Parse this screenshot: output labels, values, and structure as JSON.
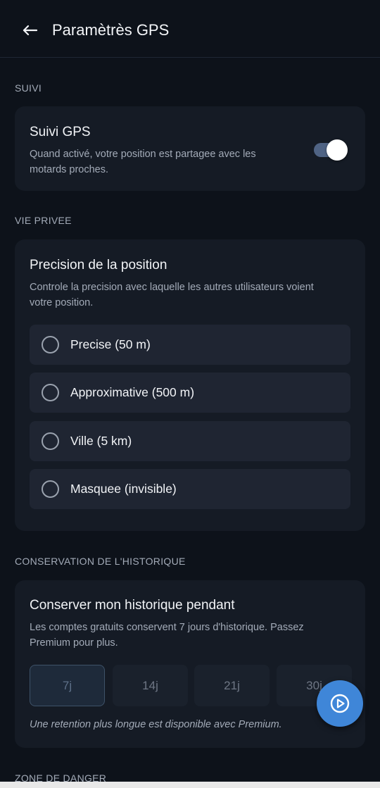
{
  "header": {
    "title": "Paramètrès GPS",
    "back_icon": "arrow-left-icon"
  },
  "sections": {
    "suivi": {
      "header": "SUIVI",
      "card": {
        "title": "Suivi GPS",
        "description_line1": "Quand activé, votre position est partagee avec les",
        "description_line2": "motards proches.",
        "toggle_on": true
      }
    },
    "privacy": {
      "header": "VIE PRIVEE",
      "card": {
        "title": "Precision de la position",
        "description_line1": "Controle la precision avec laquelle les autres utilisateurs voient",
        "description_line2": "votre position.",
        "options": [
          {
            "label": "Precise (50 m)",
            "selected": false
          },
          {
            "label": "Approximative (500 m)",
            "selected": false
          },
          {
            "label": "Ville (5 km)",
            "selected": false
          },
          {
            "label": "Masquee (invisible)",
            "selected": false
          }
        ]
      }
    },
    "history": {
      "header": "CONSERVATION DE L'HISTORIQUE",
      "card": {
        "title": "Conserver mon historique pendant",
        "description_line1": "Les comptes gratuits conservent 7 jours d'historique. Passez",
        "description_line2": "Premium pour plus.",
        "chips": [
          {
            "label": "7j",
            "selected": true
          },
          {
            "label": "14j",
            "selected": false
          },
          {
            "label": "21j",
            "selected": false
          },
          {
            "label": "30j",
            "selected": false
          }
        ],
        "note": "Une retention plus longue est disponible avec Premium."
      }
    },
    "danger": {
      "header": "ZONE DE DANGER"
    }
  },
  "fab": {
    "icon": "play-circle-icon"
  },
  "colors": {
    "background": "#0d121a",
    "card": "#151b25",
    "option": "#1f2532",
    "accent": "#3f86d8",
    "toggle_track": "#4f6384"
  }
}
